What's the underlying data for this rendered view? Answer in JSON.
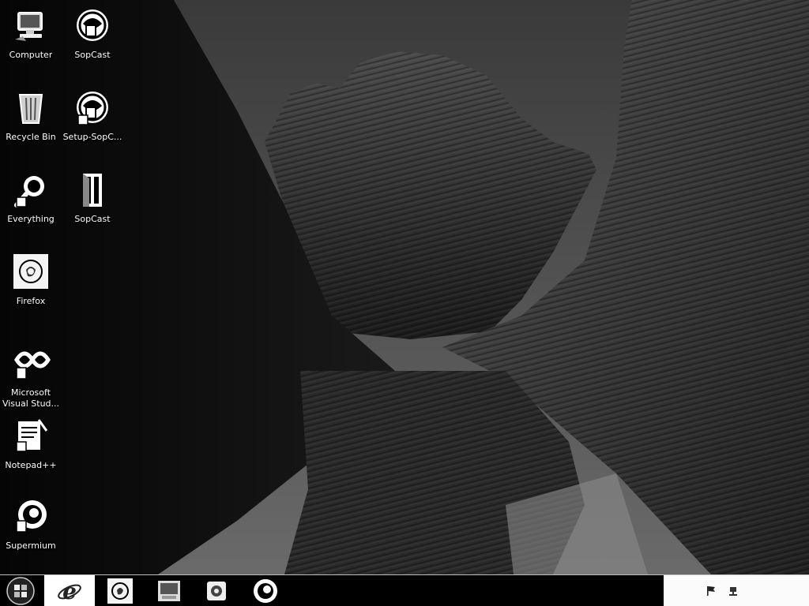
{
  "desktop": {
    "icons": [
      {
        "label": "Computer",
        "icon": "computer-icon"
      },
      {
        "label": "SopCast",
        "icon": "sopcast-icon"
      },
      {
        "label": "Recycle Bin",
        "icon": "recycle-bin-icon"
      },
      {
        "label": "Setup-SopC...",
        "icon": "sopcast-setup-icon"
      },
      {
        "label": "Everything",
        "icon": "everything-search-icon"
      },
      {
        "label": "SopCast",
        "icon": "sopcast-folder-icon"
      },
      {
        "label": "Firefox",
        "icon": "firefox-icon"
      },
      {
        "label": "Microsoft\nVisual Stud...",
        "icon": "visual-studio-icon"
      },
      {
        "label": "Notepad++",
        "icon": "notepad-plus-plus-icon"
      },
      {
        "label": "Supermium",
        "icon": "supermium-icon"
      }
    ]
  },
  "taskbar": {
    "start": {
      "icon": "start-orb-icon"
    },
    "pinned": [
      {
        "icon": "internet-explorer-icon",
        "active": true
      },
      {
        "icon": "firefox-icon",
        "active": false
      },
      {
        "icon": "computer-icon",
        "active": false
      },
      {
        "icon": "media-player-icon",
        "active": false
      },
      {
        "icon": "supermium-icon",
        "active": false
      }
    ],
    "tray": {
      "icons": [
        "action-center-flag-icon",
        "network-icon"
      ]
    }
  }
}
